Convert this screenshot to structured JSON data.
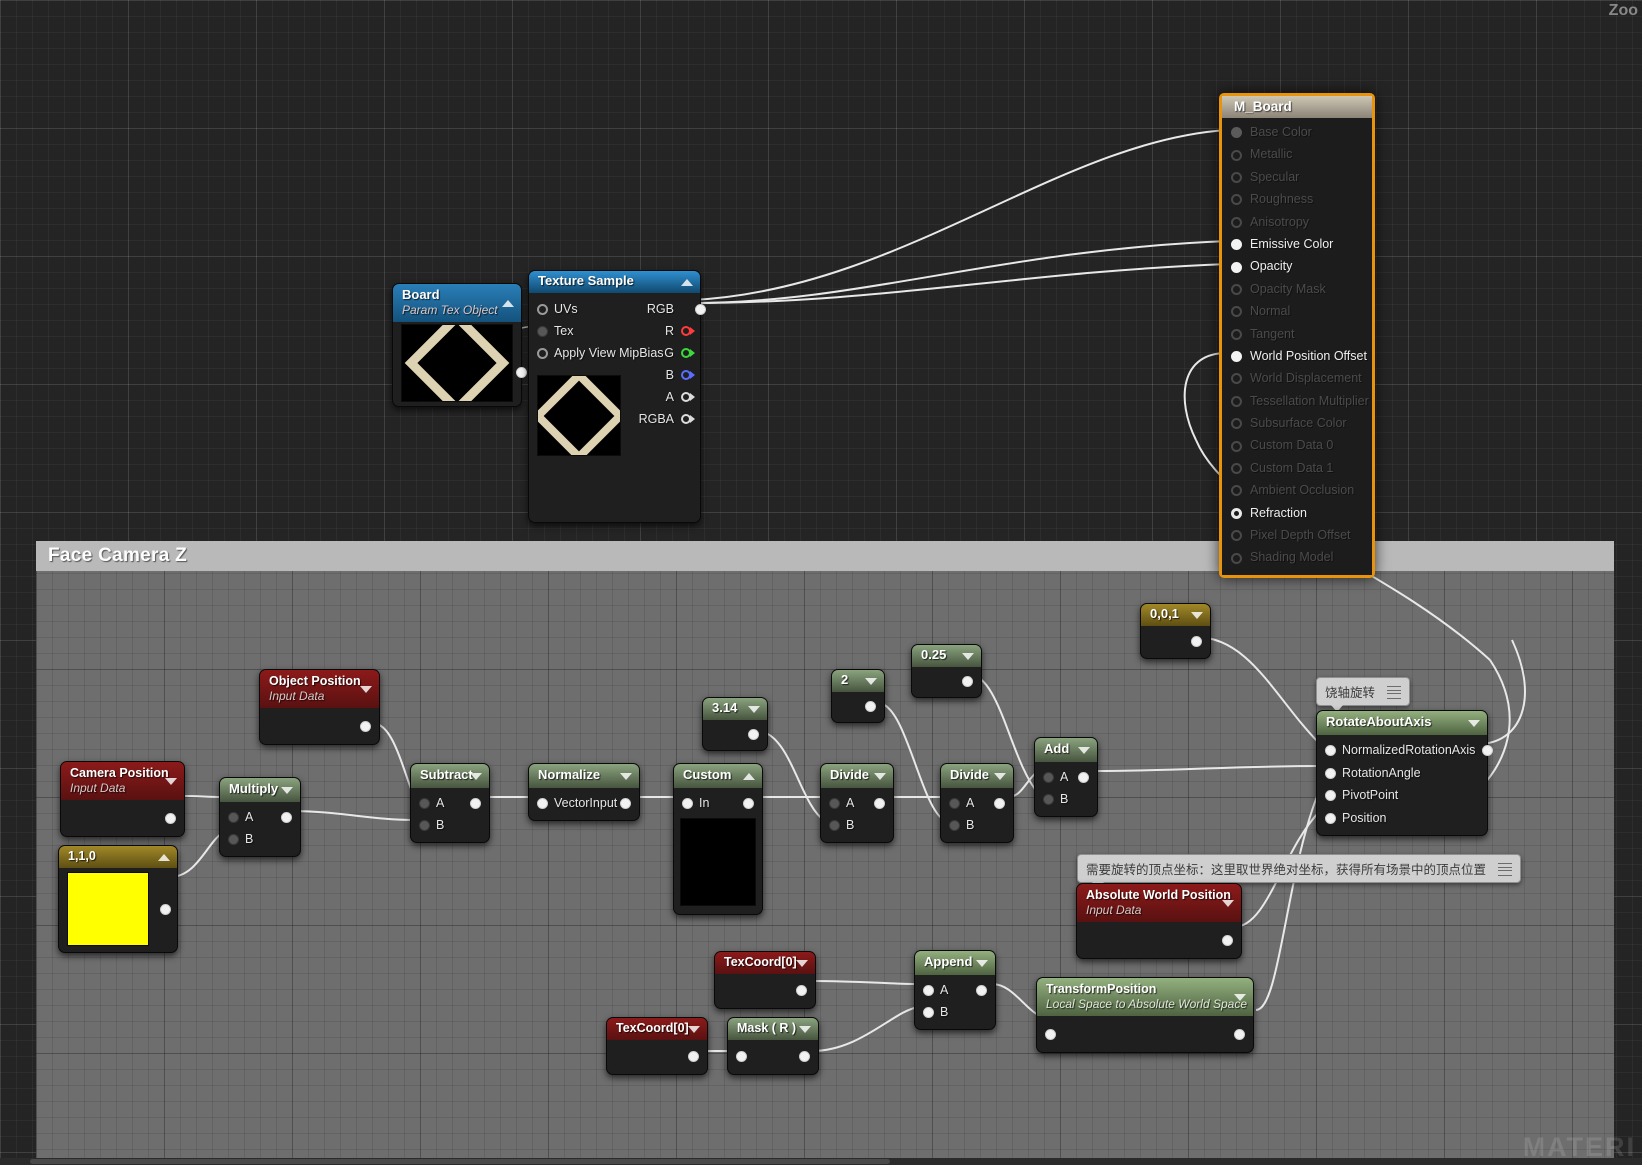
{
  "app": {
    "zoom_label": "Zoo",
    "watermark": "MATERI"
  },
  "comment_box": {
    "title": "Face  Camera Z"
  },
  "material_node": {
    "title": "M_Board",
    "inputs": [
      {
        "label": "Base Color",
        "state": "off"
      },
      {
        "label": "Metallic",
        "state": "off"
      },
      {
        "label": "Specular",
        "state": "off"
      },
      {
        "label": "Roughness",
        "state": "off"
      },
      {
        "label": "Anisotropy",
        "state": "off"
      },
      {
        "label": "Emissive Color",
        "state": "on"
      },
      {
        "label": "Opacity",
        "state": "on"
      },
      {
        "label": "Opacity Mask",
        "state": "off"
      },
      {
        "label": "Normal",
        "state": "off"
      },
      {
        "label": "Tangent",
        "state": "off"
      },
      {
        "label": "World Position Offset",
        "state": "on"
      },
      {
        "label": "World Displacement",
        "state": "off"
      },
      {
        "label": "Tessellation Multiplier",
        "state": "off"
      },
      {
        "label": "Subsurface Color",
        "state": "off"
      },
      {
        "label": "Custom Data 0",
        "state": "off"
      },
      {
        "label": "Custom Data 1",
        "state": "off"
      },
      {
        "label": "Ambient Occlusion",
        "state": "off"
      },
      {
        "label": "Refraction",
        "state": "half"
      },
      {
        "label": "Pixel Depth Offset",
        "state": "off"
      },
      {
        "label": "Shading Model",
        "state": "off"
      }
    ],
    "accent_color": "#e8930c"
  },
  "nodes": {
    "board": {
      "title": "Board",
      "subtitle": "Param Tex Object"
    },
    "texture_sample": {
      "title": "Texture Sample",
      "inputs": [
        "UVs",
        "Tex",
        "Apply View MipBias"
      ],
      "outputs": [
        "RGB",
        "R",
        "G",
        "B",
        "A",
        "RGBA"
      ]
    },
    "object_position": {
      "title": "Object Position",
      "subtitle": "Input Data"
    },
    "camera_position": {
      "title": "Camera Position",
      "subtitle": "Input Data"
    },
    "vector_110": {
      "title": "1,1,0",
      "color": "#ffff00"
    },
    "multiply": {
      "title": "Multiply",
      "inputs": [
        "A",
        "B"
      ]
    },
    "subtract": {
      "title": "Subtract",
      "inputs": [
        "A",
        "B"
      ]
    },
    "normalize": {
      "title": "Normalize",
      "inputs": [
        "VectorInput"
      ]
    },
    "custom": {
      "title": "Custom",
      "inputs": [
        "In"
      ]
    },
    "const_314": {
      "title": "3.14"
    },
    "const_2": {
      "title": "2"
    },
    "const_025": {
      "title": "0.25"
    },
    "const_001": {
      "title": "0,0,1"
    },
    "divide_1": {
      "title": "Divide",
      "inputs": [
        "A",
        "B"
      ]
    },
    "divide_2": {
      "title": "Divide",
      "inputs": [
        "A",
        "B"
      ]
    },
    "add": {
      "title": "Add",
      "inputs": [
        "A",
        "B"
      ]
    },
    "rotate_about_axis": {
      "title": "RotateAboutAxis",
      "inputs": [
        "NormalizedRotationAxis",
        "RotationAngle",
        "PivotPoint",
        "Position"
      ]
    },
    "absolute_world_position": {
      "title": "Absolute World Position",
      "subtitle": "Input Data"
    },
    "transform_position": {
      "title": "TransformPosition",
      "subtitle": "Local Space to Absolute World Space"
    },
    "texcoord_top": {
      "title": "TexCoord[0]"
    },
    "texcoord_bottom": {
      "title": "TexCoord[0]"
    },
    "mask_r": {
      "title": "Mask ( R )"
    },
    "append": {
      "title": "Append",
      "inputs": [
        "A",
        "B"
      ]
    }
  },
  "bubbles": {
    "rotate_about_axis": "饶轴旋转",
    "absolute_world_position": "需要旋转的顶点坐标：这里取世界绝对坐标，获得所有场景中的顶点位置"
  }
}
